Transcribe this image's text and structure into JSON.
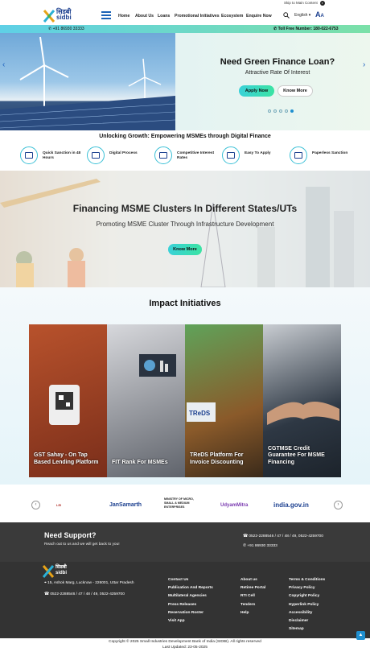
{
  "topbar": {
    "skip": "Skip to Main Content",
    "a11y": "◐"
  },
  "header": {
    "logo_hindi": "सिडबी",
    "logo_en": "sidbi",
    "nav": [
      "Home",
      "About Us",
      "Loans",
      "Promotional Initiatives",
      "Ecosystem",
      "Enquire Now"
    ],
    "language": "English"
  },
  "contact": {
    "phone": "+91 86930 33333",
    "tollfree": "Toll Free Number: 180-022-6753"
  },
  "hero": {
    "title": "Need Green Finance Loan?",
    "subtitle": "Attractive Rate Of Interest",
    "apply": "Apply Now",
    "know": "Know More",
    "prev": "‹",
    "next": "›"
  },
  "unlock_title": "Unlocking Growth: Empowering MSMEs through Digital Finance",
  "features": [
    "Quick Sanction in 48 Hours",
    "Digital Process",
    "Competitive Interest Rates",
    "Easy To Apply",
    "Paperless Sanction"
  ],
  "cluster": {
    "title": "Financing MSME Clusters In Different States/UTs",
    "subtitle": "Promoting MSME Cluster Through Infrastructure Development",
    "button": "Know More"
  },
  "impact": {
    "title": "Impact Initiatives",
    "cards": [
      {
        "title": "GST Sahay - On Tap Based Lending Platform",
        "color": "#a04a2a"
      },
      {
        "title": "FIT Rank For MSMEs",
        "color": "#7a7d86"
      },
      {
        "title": "TReDS Platform For Invoice Discounting",
        "color": "#8a6a3a"
      },
      {
        "title": "CGTMSE Credit Guarantee For MSME Financing",
        "color": "#3a4652"
      }
    ]
  },
  "partners": [
    "LEI",
    "JanSamarth",
    "MINISTRY OF MICRO, SMALL & MEDIUM ENTERPRISES",
    "UdyamMitra",
    "india.gov.in"
  ],
  "support": {
    "title": "Need Support?",
    "text": "Reach out to us and we will get back to you!",
    "phone1": "0522-2288546 / 47 / 48 / 49, 0522-4259700",
    "phone2": "+91 86930 33333"
  },
  "footer": {
    "address": "15, Ashok Marg, Lucknow - 226001, Uttar Pradesh",
    "phone": "0522-2288546 / 47 / 48 / 49, 0522-4259700",
    "col1": [
      "Contact Us",
      "Publication And Reports",
      "Multilateral Agencies",
      "Press Releases",
      "Reservation Roster",
      "Visit App"
    ],
    "col2": [
      "About us",
      "Retiree Portal",
      "RTI Cell",
      "Tenders",
      "Help"
    ],
    "col3": [
      "Terms & Conditions",
      "Privacy Policy",
      "Copyright Policy",
      "Hyperlink Policy",
      "Accessibility",
      "Disclaimer",
      "Sitemap"
    ],
    "copyright": "Copyright © 2025 Small Industries Development Bank of India (SIDBI). All rights reserved",
    "updated": "Last Updated: 23-05-2025"
  }
}
